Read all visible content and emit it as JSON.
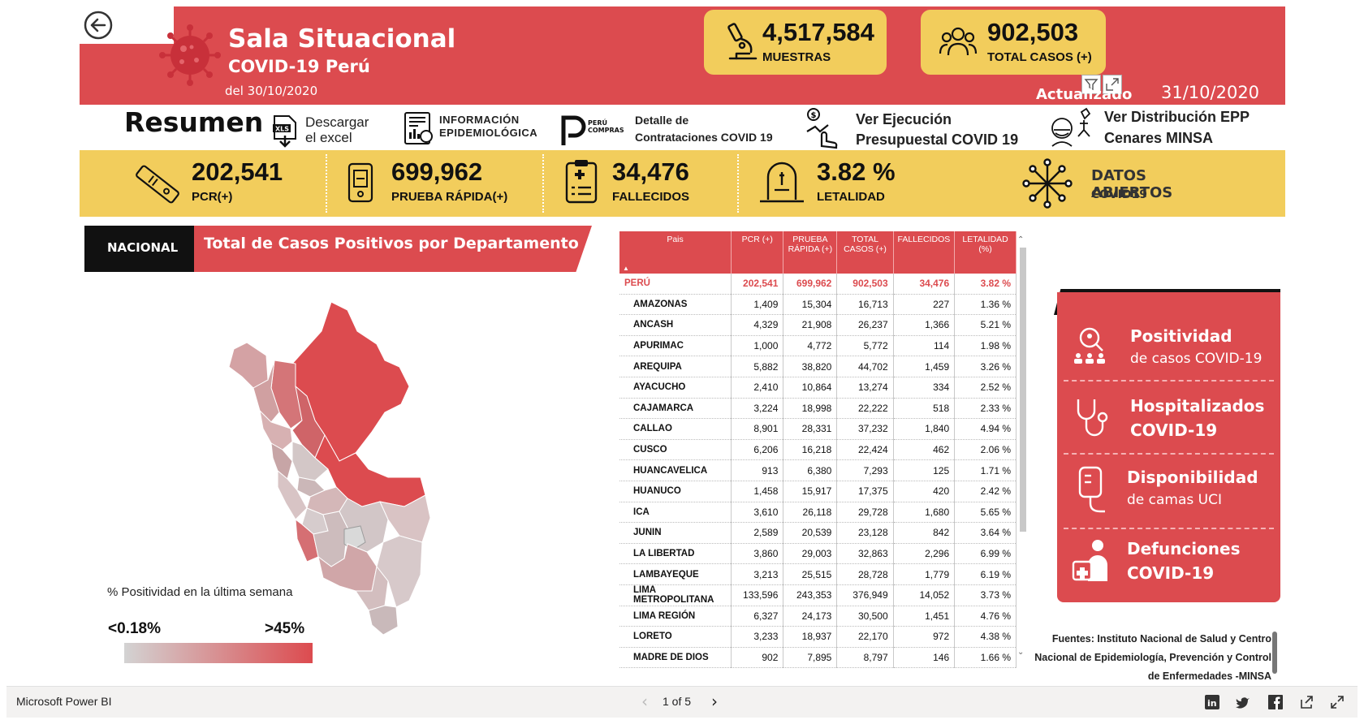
{
  "header": {
    "title": "Sala Situacional",
    "subtitle": "COVID-19 Perú",
    "date": "del 30/10/2020",
    "muestras_value": "4,517,584",
    "muestras_label": "MUESTRAS",
    "casos_value": "902,503",
    "casos_label": "TOTAL CASOS (+)",
    "updated_label": "Actualizado",
    "updated_date": "31/10/2020"
  },
  "links": {
    "resumen": "Resumen",
    "descargar_1": "Descargar",
    "descargar_2": "el excel",
    "info_1": "INFORMACIÓN",
    "info_2": "EPIDEMIOLÓGICA",
    "peru_compras_logo": "PERÚ COMPRAS",
    "contrataciones_1": "Detalle  de",
    "contrataciones_2": "Contrataciones COVID 19",
    "ejecucion_1": "Ver Ejecución",
    "ejecucion_2": "Presupuestal COVID 19",
    "epp_1": "Ver Distribución EPP",
    "epp_2": "Cenares MINSA"
  },
  "stats": {
    "pcr_value": "202,541",
    "pcr_label": "PCR(+)",
    "rapida_value": "699,962",
    "rapida_label": "PRUEBA RÁPIDA(+)",
    "fallecidos_value": "34,476",
    "fallecidos_label": "FALLECIDOS",
    "letalidad_value": "3.82 %",
    "letalidad_label": "LETALIDAD",
    "abiertos_1": "DATOS ABIERTOS",
    "abiertos_2": "COVID19"
  },
  "map_section": {
    "tab_label": "NACIONAL",
    "title": "Total de Casos Positivos por Departamento",
    "legend_caption": "% Positividad en la última semana",
    "legend_min": "<0.18%",
    "legend_max": ">45%",
    "colors": {
      "low": "#d3d3d3",
      "high": "#dc4b4f"
    }
  },
  "table": {
    "headers": [
      "Pais",
      "PCR (+)",
      "PRUEBA RÁPIDA (+)",
      "TOTAL CASOS (+)",
      "FALLECIDOS",
      "LETALIDAD (%)"
    ],
    "total": [
      "PERÚ",
      "202,541",
      "699,962",
      "902,503",
      "34,476",
      "3.82 %"
    ],
    "rows": [
      [
        "AMAZONAS",
        "1,409",
        "15,304",
        "16,713",
        "227",
        "1.36 %"
      ],
      [
        "ANCASH",
        "4,329",
        "21,908",
        "26,237",
        "1,366",
        "5.21 %"
      ],
      [
        "APURIMAC",
        "1,000",
        "4,772",
        "5,772",
        "114",
        "1.98 %"
      ],
      [
        "AREQUIPA",
        "5,882",
        "38,820",
        "44,702",
        "1,459",
        "3.26 %"
      ],
      [
        "AYACUCHO",
        "2,410",
        "10,864",
        "13,274",
        "334",
        "2.52 %"
      ],
      [
        "CAJAMARCA",
        "3,224",
        "18,998",
        "22,222",
        "518",
        "2.33 %"
      ],
      [
        "CALLAO",
        "8,901",
        "28,331",
        "37,232",
        "1,840",
        "4.94 %"
      ],
      [
        "CUSCO",
        "6,206",
        "16,218",
        "22,424",
        "462",
        "2.06 %"
      ],
      [
        "HUANCAVELICA",
        "913",
        "6,380",
        "7,293",
        "125",
        "1.71 %"
      ],
      [
        "HUANUCO",
        "1,458",
        "15,917",
        "17,375",
        "420",
        "2.42 %"
      ],
      [
        "ICA",
        "3,610",
        "26,118",
        "29,728",
        "1,680",
        "5.65 %"
      ],
      [
        "JUNIN",
        "2,589",
        "20,539",
        "23,128",
        "842",
        "3.64 %"
      ],
      [
        "LA LIBERTAD",
        "3,860",
        "29,003",
        "32,863",
        "2,296",
        "6.99 %"
      ],
      [
        "LAMBAYEQUE",
        "3,213",
        "25,515",
        "28,728",
        "1,779",
        "6.19 %"
      ],
      [
        "LIMA METROPOLITANA",
        "133,596",
        "243,353",
        "376,949",
        "14,052",
        "3.73 %"
      ],
      [
        "LIMA REGIÓN",
        "6,327",
        "24,173",
        "30,500",
        "1,451",
        "4.76 %"
      ],
      [
        "LORETO",
        "3,233",
        "18,937",
        "22,170",
        "972",
        "4.38 %"
      ],
      [
        "MADRE DE DIOS",
        "902",
        "7,895",
        "8,797",
        "146",
        "1.66 %"
      ]
    ]
  },
  "menu": [
    {
      "title": "Positividad",
      "sub": "de casos COVID-19",
      "icon": "magnifier-people-icon"
    },
    {
      "title": "Hospitalizados",
      "sub": "COVID-19",
      "icon": "stethoscope-icon"
    },
    {
      "title": "Disponibilidad",
      "sub": "de camas UCI",
      "icon": "iv-bag-icon"
    },
    {
      "title": "Defunciones",
      "sub": "COVID-19",
      "icon": "doctor-icon"
    }
  ],
  "sources": {
    "line1": "Fuentes: Instituto Nacional de Salud y Centro",
    "line2": "Nacional de Epidemiología, Prevención y Control",
    "line3": "de Enfermedades -MINSA"
  },
  "footer": {
    "app_name": "Microsoft Power BI",
    "page_indicator": "1 of 5"
  }
}
